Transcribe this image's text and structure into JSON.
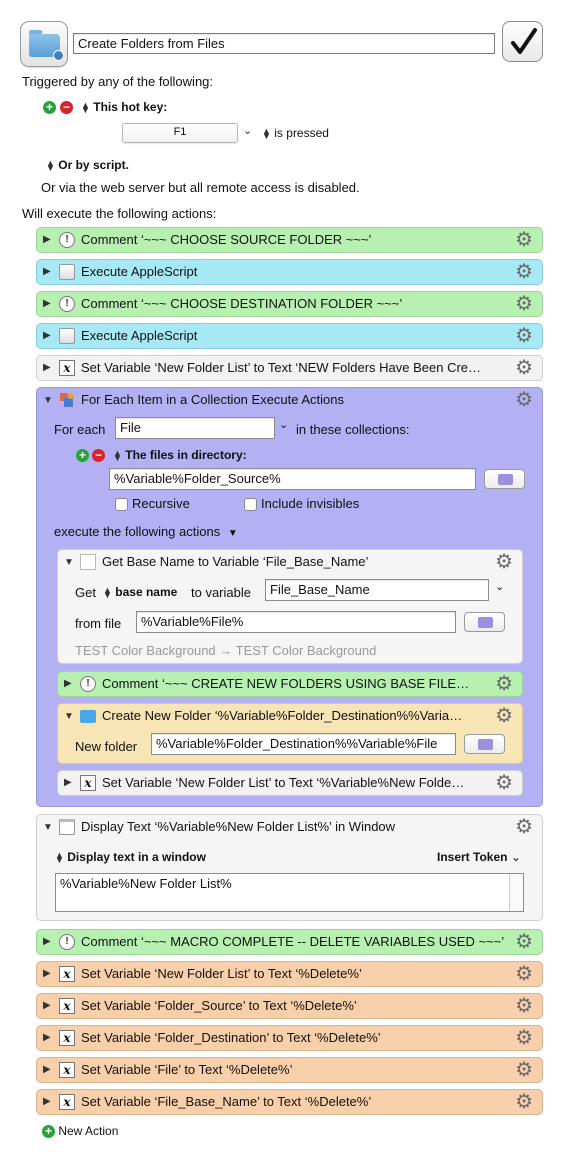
{
  "macro": {
    "name": "Create Folders from Files"
  },
  "trigger": {
    "triggered_by": "Triggered by any of the following:",
    "hotkey_label": "This hot key:",
    "hotkey_value": "F1",
    "is_pressed": "is pressed",
    "or_by_script": "Or by script.",
    "web_server_note": "Or via the web server but all remote access is disabled."
  },
  "will_execute": "Will execute the following actions:",
  "actions": [
    {
      "title": "Comment ‘~~~ CHOOSE SOURCE FOLDER ~~~’"
    },
    {
      "title": "Execute AppleScript"
    },
    {
      "title": "Comment ‘~~~ CHOOSE DESTINATION FOLDER ~~~’"
    },
    {
      "title": "Execute AppleScript"
    },
    {
      "title": "Set Variable ‘New Folder List’ to Text ‘NEW Folders Have Been Cre…"
    }
  ],
  "foreach": {
    "title": "For Each Item in a Collection Execute Actions",
    "for_each_label": "For each",
    "variable": "File",
    "in_collections": "in these collections:",
    "files_in_dir": "The files in directory:",
    "dir_value": "%Variable%Folder_Source%",
    "recursive": "Recursive",
    "include_invisibles": "Include invisibles",
    "execute_following": "execute the following actions"
  },
  "basename": {
    "title": "Get Base Name to Variable ‘File_Base_Name’",
    "get_label": "Get",
    "get_popup": "base name",
    "to_variable": "to variable",
    "variable_value": "File_Base_Name",
    "from_file_label": "from file",
    "from_file_value": "%Variable%File%",
    "test_color": "TEST Color Background → TEST Color Background"
  },
  "inner_comment": {
    "title": "Comment ‘~~~ CREATE NEW FOLDERS USING BASE FILE…"
  },
  "newfolder": {
    "title": "Create New Folder ‘%Variable%Folder_Destination%%Varia…",
    "label": "New folder",
    "value": "%Variable%Folder_Destination%%Variable%File"
  },
  "inner_setvar": {
    "title": "Set Variable ‘New Folder List’ to Text ‘%Variable%New Folde…"
  },
  "display": {
    "title": "Display Text ‘%Variable%New Folder List%’ in Window",
    "mode": "Display text in a window",
    "insert_token": "Insert Token",
    "text": "%Variable%New Folder List%"
  },
  "tail_actions": [
    {
      "title": "Comment ‘~~~ MACRO COMPLETE -- DELETE VARIABLES USED ~~~’"
    },
    {
      "title": "Set Variable ‘New Folder List’ to Text ‘%Delete%’"
    },
    {
      "title": "Set Variable ‘Folder_Source’ to Text ‘%Delete%’"
    },
    {
      "title": "Set Variable ‘Folder_Destination’ to Text ‘%Delete%’"
    },
    {
      "title": "Set Variable ‘File’ to Text ‘%Delete%’"
    },
    {
      "title": "Set Variable ‘File_Base_Name’ to Text ‘%Delete%’"
    }
  ],
  "new_action": "New Action",
  "colors": {
    "comment_green": "#b7f0b1",
    "applescript_cyan": "#a6e9f5",
    "foreach_purple": "#b3b1f3",
    "delete_orange": "#f8cfab",
    "newfolder_yellow": "#f8e5b5"
  }
}
